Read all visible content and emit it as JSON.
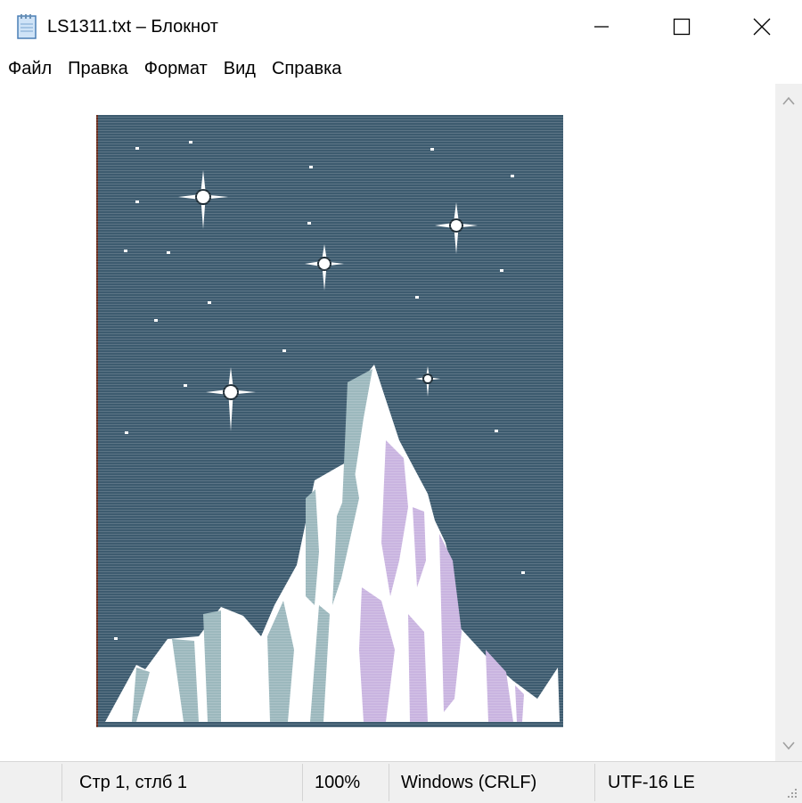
{
  "window": {
    "title": "LS1311.txt – Блокнот",
    "controls": [
      "minimize",
      "maximize",
      "close"
    ]
  },
  "menu": {
    "items": [
      "Файл",
      "Правка",
      "Формат",
      "Вид",
      "Справка"
    ]
  },
  "editor": {
    "content_kind": "ascii-art-picture",
    "colors": {
      "sky": "#3d5b6f",
      "ice_white": "#ffffff",
      "ice_teal": "#9cb8bd",
      "ice_lilac": "#c9b4e0"
    }
  },
  "status": {
    "position": "Стр 1, стлб 1",
    "zoom": "100%",
    "line_ending": "Windows (CRLF)",
    "encoding": "UTF-16 LE"
  }
}
